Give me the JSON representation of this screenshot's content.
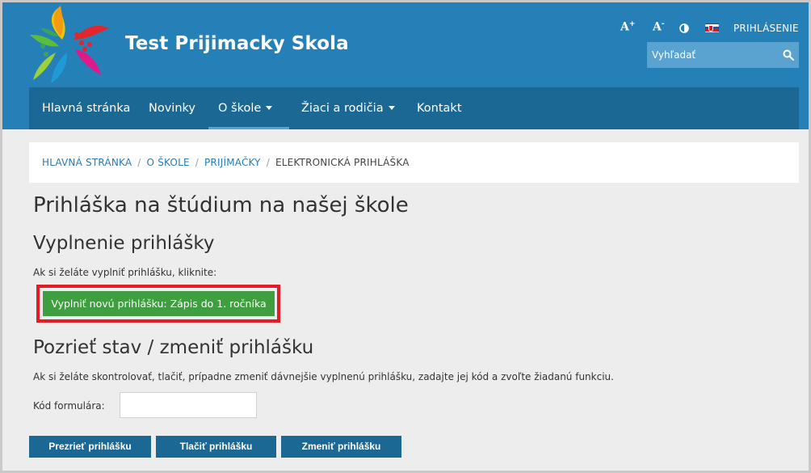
{
  "header": {
    "site_title": "Test Prijimacky Skola",
    "tools": {
      "font_increase": "A",
      "font_increase_sup": "+",
      "font_decrease": "A",
      "font_decrease_sup": "-",
      "contrast_icon": "contrast-icon",
      "flag_icon": "slovak-flag-icon",
      "login": "PRIHLÁSENIE"
    },
    "search": {
      "placeholder": "Vyhľadať",
      "icon": "search-icon"
    }
  },
  "nav": {
    "items": [
      {
        "label": "Hlavná stránka",
        "dropdown": false
      },
      {
        "label": "Novinky",
        "dropdown": false
      },
      {
        "label": "O škole",
        "dropdown": true,
        "active": true
      },
      {
        "label": "Žiaci a rodičia",
        "dropdown": true
      },
      {
        "label": "Kontakt",
        "dropdown": false
      }
    ]
  },
  "breadcrumb": {
    "items": [
      "HLAVNÁ STRÁNKA",
      "O ŠKOLE",
      "PRIJÍMAČKY"
    ],
    "separator": "/",
    "current": "ELEKTRONICKÁ PRIHLÁŠKA"
  },
  "main": {
    "title": "Prihláška na štúdium na našej škole",
    "section1": {
      "heading": "Vyplnenie prihlášky",
      "text": "Ak si želáte vyplniť prihlášku, kliknite:",
      "button": "Vyplniť novú prihlášku: Zápis do 1. ročníka"
    },
    "section2": {
      "heading": "Pozrieť stav / zmeniť prihlášku",
      "text": "Ak si želáte skontrolovať, tlačiť, prípadne zmeniť dávnejšie vyplnenú prihlášku, zadajte jej kód a zvoľte žiadanú funkciu.",
      "code_label": "Kód formulára:",
      "code_value": "",
      "buttons": {
        "view": "Prezrieť prihlášku",
        "print": "Tlačiť prihlášku",
        "change": "Zmeniť prihlášku"
      }
    }
  },
  "colors": {
    "header_bg": "#2580b8",
    "nav_bg": "#1c6895",
    "green_button": "#3f9e3f",
    "highlight_border": "#e31b23"
  }
}
